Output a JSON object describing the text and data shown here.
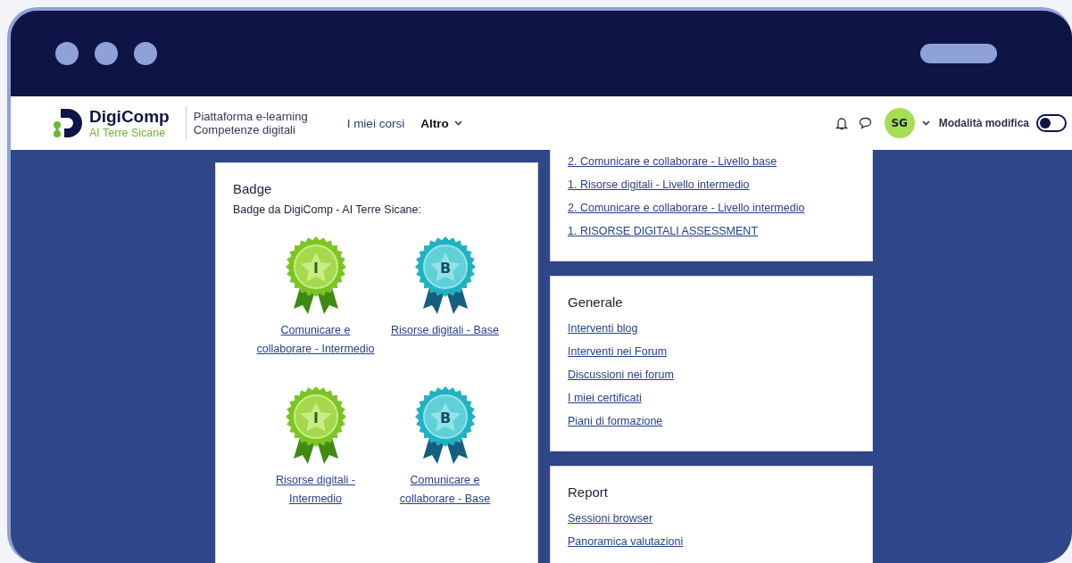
{
  "header": {
    "logo": {
      "name": "DigiComp",
      "subtitle": "AI Terre Sicane"
    },
    "platform": [
      "Piattaforma e-learning",
      "Competenze digitali"
    ],
    "nav": [
      {
        "label": "I miei corsi",
        "dropdown": false
      },
      {
        "label": "Altro",
        "dropdown": true
      }
    ],
    "avatar": "SG",
    "edit_mode": {
      "label": "Modalità modifica",
      "on": false
    }
  },
  "badge_card": {
    "title": "Badge",
    "subtitle": "Badge da DigiComp - AI Terre Sicane:",
    "badges": [
      {
        "kind": "intermediate",
        "letter": "I",
        "label": "Comunicare e collaborare - Intermedio"
      },
      {
        "kind": "base",
        "letter": "B",
        "label": "Risorse digitali - Base"
      },
      {
        "kind": "intermediate",
        "letter": "I",
        "label": "Risorse digitali - Intermedio"
      },
      {
        "kind": "base",
        "letter": "B",
        "label": "Comunicare e collaborare - Base"
      }
    ]
  },
  "course_links": [
    "2. Comunicare e collaborare - Livello base",
    "1. Risorse digitali - Livello intermedio",
    "2. Comunicare e collaborare - Livello intermedio",
    "1. RISORSE DIGITALI ASSESSMENT"
  ],
  "sections": [
    {
      "title": "Generale",
      "links": [
        "Interventi blog",
        "Interventi nei Forum",
        "Discussioni nei forum",
        "I miei certificati",
        "Piani di formazione"
      ]
    },
    {
      "title": "Report",
      "links": [
        "Sessioni browser",
        "Panoramica valutazioni"
      ]
    }
  ]
}
